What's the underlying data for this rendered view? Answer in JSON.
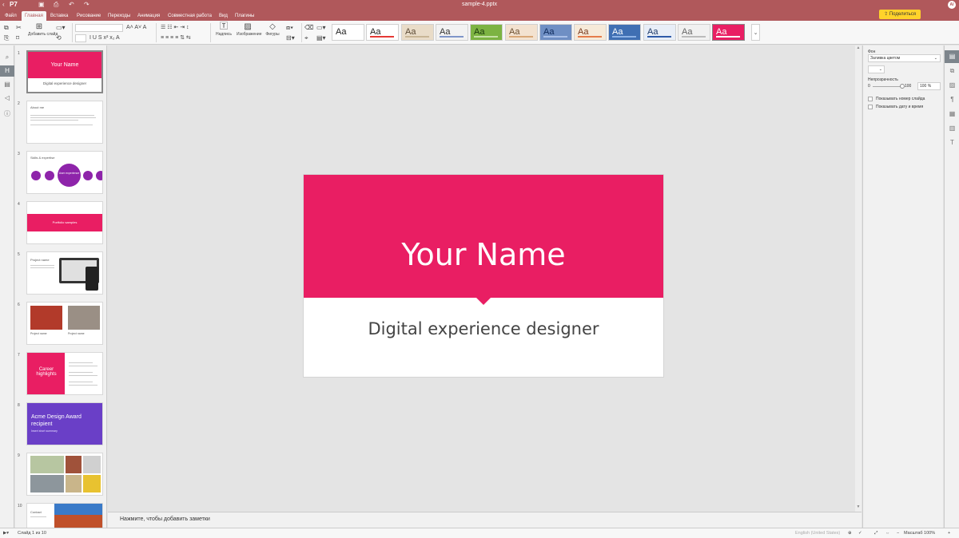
{
  "app": {
    "document_title": "sample-4.pptx",
    "logo_text": "P7"
  },
  "menu": {
    "tabs": [
      "Файл",
      "Главная",
      "Вставка",
      "Рисование",
      "Переходы",
      "Анимация",
      "Совместная работа",
      "Вид",
      "Плагины"
    ],
    "active_tab": "Главная",
    "share_label": "Поделиться",
    "avatar_initials": "AI"
  },
  "toolbar": {
    "add_slide_label": "Добавить слайд",
    "text_label": "Надпись",
    "image_label": "Изображение",
    "shapes_label": "Фигуры",
    "themes": [
      {
        "name": "theme-1",
        "bg": "#ffffff",
        "fg": "#222222",
        "accent": "#ffffff"
      },
      {
        "name": "theme-2",
        "bg": "#ffffff",
        "fg": "#222222",
        "accent": "#e53935"
      },
      {
        "name": "theme-3",
        "bg": "#e9dcc8",
        "fg": "#5b4a35",
        "accent": "#c8b596"
      },
      {
        "name": "theme-4",
        "bg": "#f2f2f2",
        "fg": "#333333",
        "accent": "#7f96c9"
      },
      {
        "name": "theme-5",
        "bg": "#7cb342",
        "fg": "#1b3a0d",
        "accent": "#c5e1a5"
      },
      {
        "name": "theme-6",
        "bg": "#f3e2d0",
        "fg": "#6b4e2e",
        "accent": "#d9a878"
      },
      {
        "name": "theme-7",
        "bg": "#6f8fc4",
        "fg": "#0e2a5c",
        "accent": "#a9c0e8"
      },
      {
        "name": "theme-8",
        "bg": "#f6ead9",
        "fg": "#7a3b1e",
        "accent": "#e57c4a"
      },
      {
        "name": "theme-9",
        "bg": "#3f6fb3",
        "fg": "#ffffff",
        "accent": "#8db2e6"
      },
      {
        "name": "theme-10",
        "bg": "#e8eef7",
        "fg": "#1e3a6a",
        "accent": "#2e5aa8"
      },
      {
        "name": "theme-11",
        "bg": "#f1f1f1",
        "fg": "#666666",
        "accent": "#bbbbbb"
      },
      {
        "name": "theme-12",
        "bg": "#e91e63",
        "fg": "#ffffff",
        "accent": "#ffffff"
      }
    ],
    "theme_sample_text": "Aa"
  },
  "thumbnails": [
    {
      "num": "1",
      "title": "Your Name",
      "subtitle": "Digital experience designer"
    },
    {
      "num": "2",
      "title": "About me"
    },
    {
      "num": "3",
      "title": "Skills & expertise",
      "center": "User experience"
    },
    {
      "num": "4",
      "title": "Portfolio samples"
    },
    {
      "num": "5",
      "title": "Project name"
    },
    {
      "num": "6",
      "title": "Project name",
      "title2": "Project name"
    },
    {
      "num": "7",
      "title": "Career highlights"
    },
    {
      "num": "8",
      "title": "Acme Design Award recipient",
      "subtitle": "Insert short summary"
    },
    {
      "num": "9"
    },
    {
      "num": "10",
      "title": "Contact"
    }
  ],
  "slide": {
    "title": "Your Name",
    "subtitle": "Digital experience designer",
    "accent_color": "#e91e63"
  },
  "notes": {
    "placeholder": "Нажмите, чтобы добавить заметки"
  },
  "right_panel": {
    "background_label": "Фон",
    "fill_value": "Заливка цветом",
    "opacity_label": "Непрозрачность",
    "opacity_min": "0",
    "opacity_max": "100",
    "opacity_value": "100 %",
    "show_slide_number": "Показывать номер слайда",
    "show_date_time": "Показывать дату и время"
  },
  "status": {
    "slide_counter": "Слайд 1 из 10",
    "language": "English (United States)",
    "zoom_label": "Масштаб 100%"
  }
}
